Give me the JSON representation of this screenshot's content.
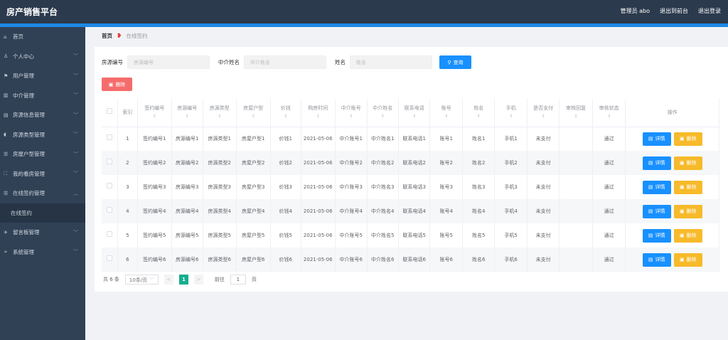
{
  "header": {
    "title": "房产销售平台",
    "user": "管理员 abo",
    "to_front": "退出到前台",
    "logout": "退出登录"
  },
  "sidebar": {
    "items": [
      {
        "label": "首页",
        "icon": "home-icon",
        "chev": ""
      },
      {
        "label": "个人中心",
        "icon": "user-icon",
        "chev": "﹀"
      },
      {
        "label": "用户管理",
        "icon": "flag-icon",
        "chev": "﹀"
      },
      {
        "label": "中介管理",
        "icon": "chart-icon",
        "chev": "﹀"
      },
      {
        "label": "房源信息管理",
        "icon": "list-icon",
        "chev": "﹀"
      },
      {
        "label": "房源类型管理",
        "icon": "mic-icon",
        "chev": "﹀"
      },
      {
        "label": "房屋户型管理",
        "icon": "menu-icon",
        "chev": "﹀"
      },
      {
        "label": "我的看房管理",
        "icon": "frame-icon",
        "chev": "﹀"
      },
      {
        "label": "在线签约管理",
        "icon": "menu-icon",
        "chev": "︿"
      },
      {
        "label": "在线签约",
        "icon": "",
        "chev": "",
        "sub": true
      },
      {
        "label": "留言板管理",
        "icon": "send-icon",
        "chev": "﹀"
      },
      {
        "label": "系统管理",
        "icon": "nav-icon",
        "chev": "﹀"
      }
    ]
  },
  "breadcrumb": {
    "home": "首页",
    "current": "在线签约"
  },
  "search": {
    "f1_label": "房源编号",
    "f1_ph": "房源编号",
    "f2_label": "中介姓名",
    "f2_ph": "中介姓名",
    "f3_label": "姓名",
    "f3_ph": "姓名",
    "query": "查询"
  },
  "delete_label": "删除",
  "table": {
    "headers": [
      "索引",
      "签约编号",
      "房源编号",
      "房源类型",
      "房屋户型",
      "价钱",
      "购房时间",
      "中介账号",
      "中介姓名",
      "联系电话",
      "账号",
      "姓名",
      "手机",
      "是否支付",
      "审核回复",
      "审核状态",
      "操作"
    ],
    "rows": [
      [
        "1",
        "签约编号1",
        "房源编号1",
        "房源类型1",
        "房屋户型1",
        "价钱1",
        "2021-05-06",
        "中介账号1",
        "中介姓名1",
        "联系电话1",
        "账号1",
        "姓名1",
        "手机1",
        "未支付",
        "",
        "通过"
      ],
      [
        "2",
        "签约编号2",
        "房源编号2",
        "房源类型2",
        "房屋户型2",
        "价钱2",
        "2021-05-06",
        "中介账号2",
        "中介姓名2",
        "联系电话2",
        "账号2",
        "姓名2",
        "手机2",
        "未支付",
        "",
        "通过"
      ],
      [
        "3",
        "签约编号3",
        "房源编号3",
        "房源类型3",
        "房屋户型3",
        "价钱3",
        "2021-05-06",
        "中介账号3",
        "中介姓名3",
        "联系电话3",
        "账号3",
        "姓名3",
        "手机3",
        "未支付",
        "",
        "通过"
      ],
      [
        "4",
        "签约编号4",
        "房源编号4",
        "房源类型4",
        "房屋户型4",
        "价钱4",
        "2021-05-06",
        "中介账号4",
        "中介姓名4",
        "联系电话4",
        "账号4",
        "姓名4",
        "手机4",
        "未支付",
        "",
        "通过"
      ],
      [
        "5",
        "签约编号5",
        "房源编号5",
        "房源类型5",
        "房屋户型5",
        "价钱5",
        "2021-05-06",
        "中介账号5",
        "中介姓名5",
        "联系电话5",
        "账号5",
        "姓名5",
        "手机5",
        "未支付",
        "",
        "通过"
      ],
      [
        "6",
        "签约编号6",
        "房源编号6",
        "房源类型6",
        "房屋户型6",
        "价钱6",
        "2021-05-06",
        "中介账号6",
        "中介姓名6",
        "联系电话6",
        "账号6",
        "姓名6",
        "手机6",
        "未支付",
        "",
        "通过"
      ]
    ],
    "detail_label": "详情",
    "delete_label": "删除"
  },
  "pagination": {
    "total": "共 6 条",
    "page_size": "10条/页",
    "prev": "<",
    "current": "1",
    "next": ">",
    "goto": "前往",
    "goto_value": "1",
    "page_unit": "页"
  }
}
